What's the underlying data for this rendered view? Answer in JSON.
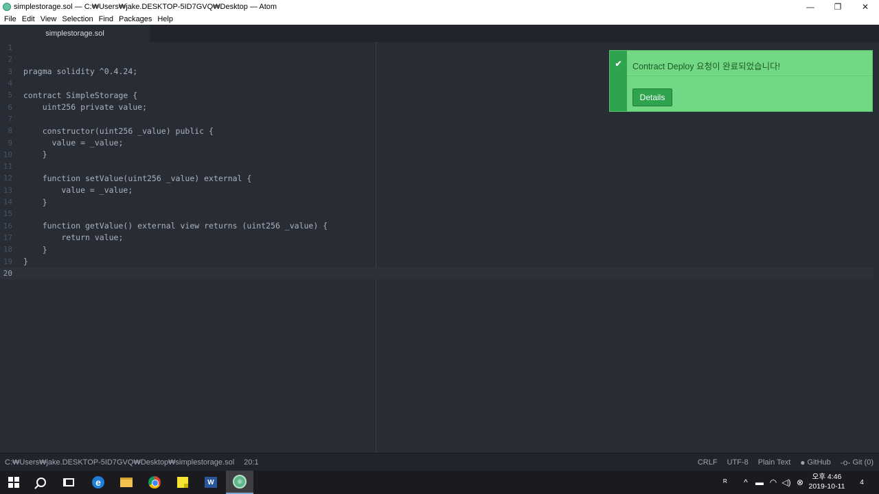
{
  "window": {
    "title": "simplestorage.sol — C:₩Users₩jake.DESKTOP-5ID7GVQ₩Desktop — Atom",
    "minimize": "—",
    "restore": "❐",
    "close": "✕"
  },
  "menu": [
    "File",
    "Edit",
    "View",
    "Selection",
    "Find",
    "Packages",
    "Help"
  ],
  "tab": {
    "label": "simplestorage.sol"
  },
  "editor": {
    "lines": [
      {
        "num": "1",
        "text": ""
      },
      {
        "num": "2",
        "text": ""
      },
      {
        "num": "3",
        "text": "pragma solidity ^0.4.24;"
      },
      {
        "num": "4",
        "text": ""
      },
      {
        "num": "5",
        "text": "contract SimpleStorage {"
      },
      {
        "num": "6",
        "text": "    uint256 private value;"
      },
      {
        "num": "7",
        "text": ""
      },
      {
        "num": "8",
        "text": "    constructor(uint256 _value) public {"
      },
      {
        "num": "9",
        "text": "      value = _value;"
      },
      {
        "num": "10",
        "text": "    }"
      },
      {
        "num": "11",
        "text": ""
      },
      {
        "num": "12",
        "text": "    function setValue(uint256 _value) external {"
      },
      {
        "num": "13",
        "text": "        value = _value;"
      },
      {
        "num": "14",
        "text": "    }"
      },
      {
        "num": "15",
        "text": ""
      },
      {
        "num": "16",
        "text": "    function getValue() external view returns (uint256 _value) {"
      },
      {
        "num": "17",
        "text": "        return value;"
      },
      {
        "num": "18",
        "text": "    }"
      },
      {
        "num": "19",
        "text": "}"
      },
      {
        "num": "20",
        "text": ""
      }
    ],
    "cursor_line": "20"
  },
  "notification": {
    "icon": "check-icon",
    "glyph": "✔",
    "message": "Contract Deploy 요청이 완료되었습니다!",
    "details_label": "Details"
  },
  "status": {
    "path": "C:₩Users₩jake.DESKTOP-5ID7GVQ₩Desktop₩simplestorage.sol",
    "position": "20:1",
    "line_ending": "CRLF",
    "encoding": "UTF-8",
    "grammar": "Plain Text",
    "github": "GitHub",
    "git": "Git (0)"
  },
  "taskbar": {
    "word_letter": "W",
    "edge_letter": "e",
    "clock_ampm_time": "오후 4:46",
    "clock_date": "2019-10-11",
    "notifications_count": "4"
  }
}
